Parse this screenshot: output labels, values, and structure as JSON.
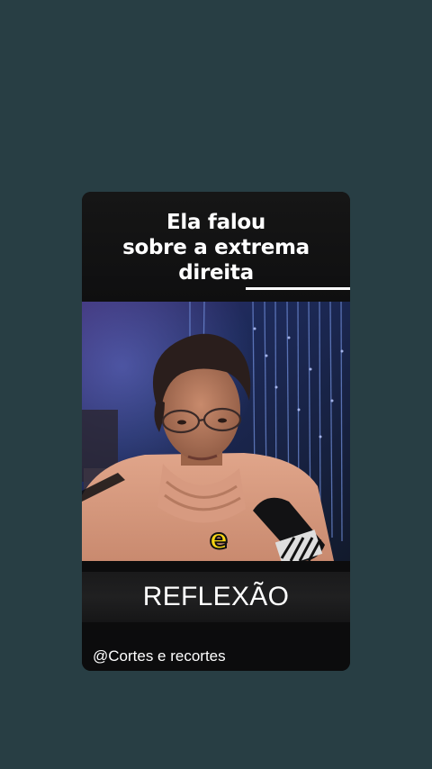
{
  "caption": {
    "line1": "Ela falou",
    "line2": "sobre a extrema",
    "line3": "direita"
  },
  "subtitle": {
    "word": "e"
  },
  "title": "REFLEXÃO",
  "channel_handle": "@Cortes e recortes",
  "colors": {
    "background": "#283e44",
    "subtitle_yellow": "#f5d313",
    "card": "#0d0d0e"
  }
}
